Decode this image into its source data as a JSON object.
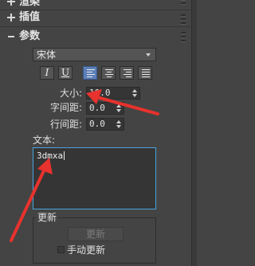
{
  "sections": {
    "render": {
      "title": "渲染"
    },
    "interp": {
      "title": "插值"
    },
    "params": {
      "title": "参数"
    }
  },
  "font": {
    "selected": "宋体"
  },
  "format_buttons": {
    "italic": "I",
    "underline": "U",
    "align_left_active": true
  },
  "fields": {
    "size": {
      "label": "大小:",
      "value": "10.0"
    },
    "kerning": {
      "label": "字间距:",
      "value": "0.0"
    },
    "leading": {
      "label": "行间距:",
      "value": "0.0"
    }
  },
  "text": {
    "label": "文本:",
    "value": "3dmxa"
  },
  "update": {
    "group_label": "更新",
    "button_label": "更新",
    "manual_label": "手动更新",
    "manual_checked": false
  },
  "colors": {
    "panel_bg": "#444444",
    "active_button": "#5c7fb8",
    "textarea_focus": "#4aa3e0",
    "annotation_arrow": "#e8322d"
  }
}
